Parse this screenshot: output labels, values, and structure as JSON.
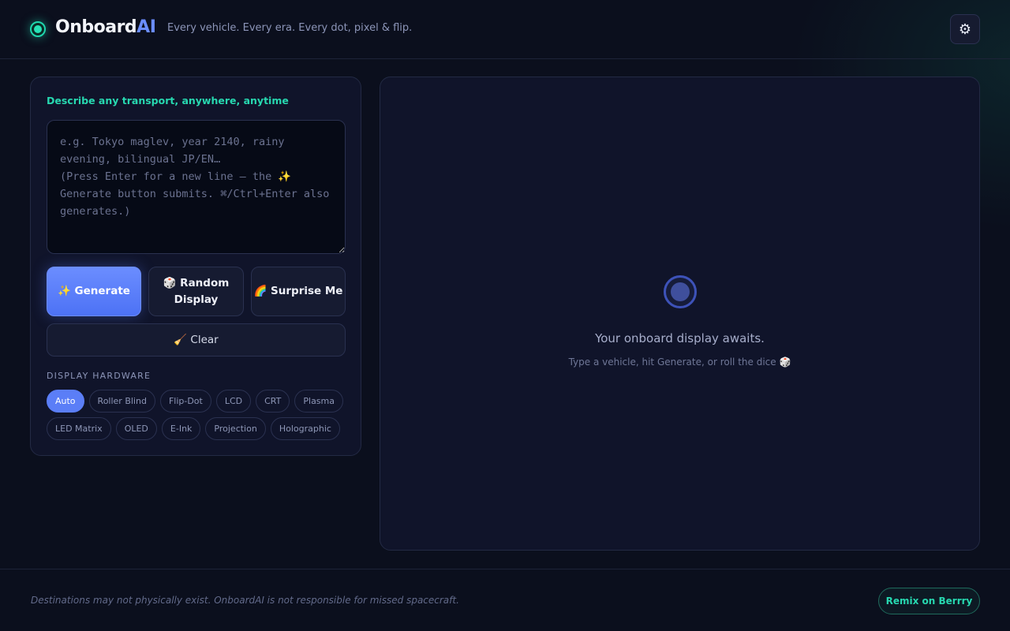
{
  "header": {
    "brand_main": "Onboard",
    "brand_accent": "AI",
    "tagline": "Every vehicle. Every era. Every dot, pixel & flip.",
    "settings_icon": "⚙"
  },
  "composer": {
    "title": "Describe any transport, anywhere, anytime",
    "placeholder": "e.g. Tokyo maglev, year 2140, rainy evening, bilingual JP/EN…\n(Press Enter for a new line — the ✨ Generate button submits. ⌘/Ctrl+Enter also generates.)",
    "value": "",
    "generate_label": "✨ Generate",
    "random_label": "🎲 Random Display",
    "surprise_label": "🌈 Surprise Me",
    "clear_label": "🧹 Clear"
  },
  "hardware": {
    "label": "DISPLAY HARDWARE",
    "selected": "Auto",
    "row1": [
      "Auto",
      "Roller Blind",
      "Flip-Dot",
      "LCD",
      "CRT",
      "Plasma"
    ],
    "row2": [
      "LED Matrix",
      "OLED",
      "E-Ink",
      "Projection",
      "Holographic"
    ]
  },
  "preview": {
    "empty_title": "Your onboard display awaits.",
    "empty_subtitle": "Type a vehicle, hit Generate, or roll the dice 🎲"
  },
  "footer": {
    "disclaimer": "Destinations may not physically exist. OnboardAI is not responsible for missed spacecraft.",
    "remix_label": "Remix on Berrry"
  },
  "colors": {
    "background": "#0b0f1d",
    "accent_teal": "#27d8b0",
    "accent_blue": "#5b7ef7"
  }
}
